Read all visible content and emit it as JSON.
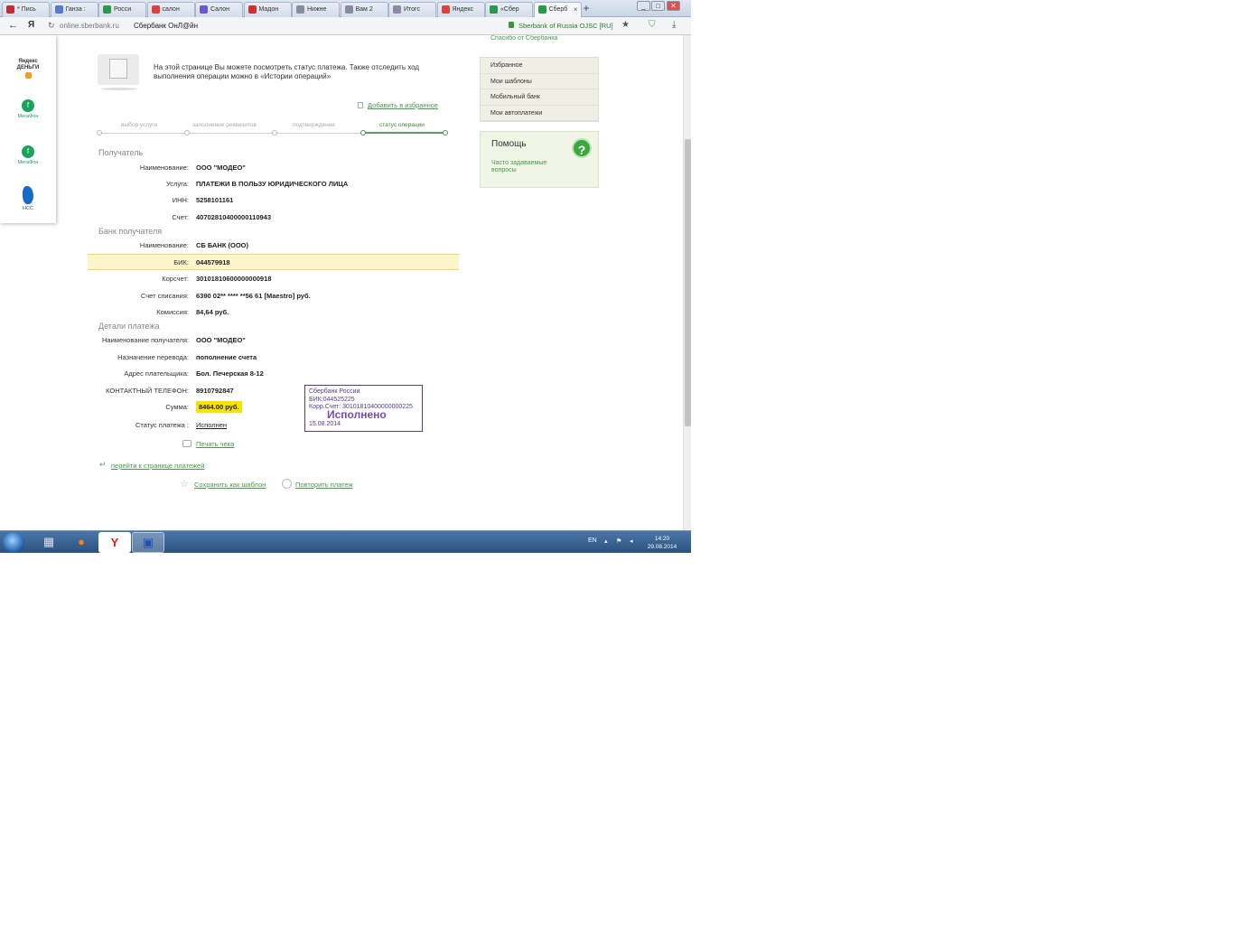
{
  "browser": {
    "tabs": [
      {
        "label": "* Пись",
        "fav_color": "#c03030"
      },
      {
        "label": "Ганза :",
        "fav_color": "#5a7ad0"
      },
      {
        "label": "Росси",
        "fav_color": "#2a9a4a"
      },
      {
        "label": "салон",
        "fav_color": "#e04040"
      },
      {
        "label": "Салон",
        "fav_color": "#6a5ad0"
      },
      {
        "label": "Мадон",
        "fav_color": "#d03030"
      },
      {
        "label": "Нижне",
        "fav_color": "#8a8aa0"
      },
      {
        "label": "Вам 2",
        "fav_color": "#8a8aa0"
      },
      {
        "label": "Итогс",
        "fav_color": "#8a8aa0"
      },
      {
        "label": "Яндекс",
        "fav_color": "#e04040"
      },
      {
        "label": "«Сбер",
        "fav_color": "#2a9a4a"
      },
      {
        "label": "Сберб",
        "fav_color": "#2a9a4a",
        "active": true
      }
    ],
    "new_tab": "+",
    "url": "online.sberbank.ru",
    "page_title": "Сбербанк ОнЛ@йн",
    "secure_label": "Sberbank of Russia OJSC [RU]",
    "yandex_label": "Я"
  },
  "promo": [
    {
      "name": "yandex-money",
      "label": "Яндекс ДЕНЬГИ"
    },
    {
      "name": "megafon-1",
      "label": "МегаФон"
    },
    {
      "name": "megafon-2",
      "label": "МегаФон"
    },
    {
      "name": "nss",
      "label": "НСС"
    }
  ],
  "info_text": "На этой странице Вы можете посмотреть статус платежа. Также отследить ход выполнения операции можно в «Истории операций»",
  "add_favorite": "Добавить в избранное",
  "steps": [
    {
      "label": "выбор услуги"
    },
    {
      "label": "заполнение реквизитов"
    },
    {
      "label": "подтверждение"
    },
    {
      "label": "статус операции",
      "active": true
    }
  ],
  "sections": {
    "recipient": "Получатель",
    "bank": "Банк получателя",
    "details": "Детали платежа"
  },
  "recipient": {
    "name_label": "Наименование:",
    "name": "ООО \"МОДЕО\"",
    "service_label": "Услуга:",
    "service": "ПЛАТЕЖИ В ПОЛЬЗУ ЮРИДИЧЕСКОГО ЛИЦА",
    "inn_label": "ИНН:",
    "inn": "5258101161",
    "account_label": "Счет:",
    "account": "40702810400000110943"
  },
  "bank": {
    "name_label": "Наименование:",
    "name": "СБ БАНК (ООО)",
    "bik_label": "БИК:",
    "bik": "044579918",
    "corr_label": "Корсчет:",
    "corr": "30101810600000000918",
    "debit_label": "Счет списания:",
    "debit": "6390 02** **** **56 61  [Maestro]  руб.",
    "fee_label": "Комиссия:",
    "fee": "84,64 руб."
  },
  "details": {
    "recipient_label": "Наименование получателя:",
    "recipient": "ООО \"МОДЕО\"",
    "purpose_label": "Назначение перевода:",
    "purpose": "пополнение счета",
    "address_label": "Адрес плательщика:",
    "address": "Бол. Печерская 8-12",
    "phone_label": "КОНТАКТНЫЙ ТЕЛЕФОН:",
    "phone": "8910792847",
    "sum_label": "Сумма:",
    "sum": "8464.00 руб.",
    "status_label": "Статус платежа :",
    "status": "Исполнен"
  },
  "stamp": {
    "line1": "Сбербанк России",
    "line2": "БИК:044525225",
    "line3": "Корр.Счет: 30101810400000000225",
    "big": "Исполнено",
    "date": "15.08.2014"
  },
  "actions": {
    "print": "Печать чека",
    "back": "перейти к странице платежей",
    "save_template": "Сохранить как шаблон",
    "repeat": "Повторить платеж"
  },
  "right": {
    "thanks": "Спасибо от Сбербанка",
    "menu": [
      "Избранное",
      "Мои шаблоны",
      "Мобильный банк",
      "Мои автоплатежи"
    ],
    "help_title": "Помощь",
    "help_link": "Часто задаваемые вопросы",
    "help_icon": "?"
  },
  "taskbar": {
    "lang": "EN",
    "time": "14:20",
    "date": "29.08.2014"
  }
}
